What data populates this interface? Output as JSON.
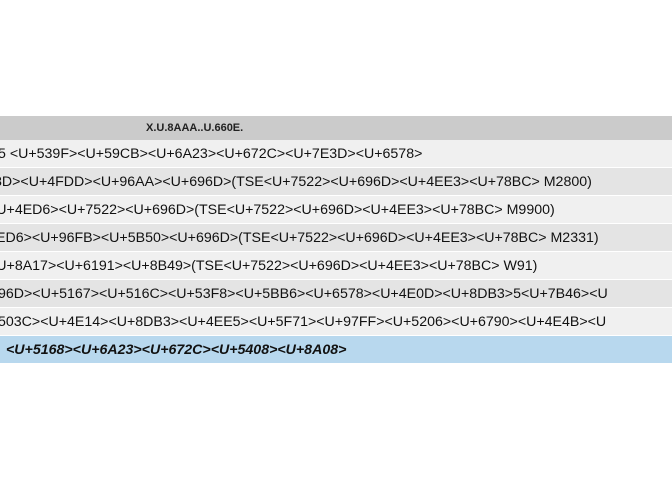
{
  "table": {
    "column_header": "X.U.8AAA..U.660E.",
    "rows": [
      {
        "text": "5 <U+539F><U+59CB><U+6A23><U+672C><U+7E3D><U+6578>",
        "offset": -2
      },
      {
        "text": "8D><U+4FDD><U+96AA><U+696D>(TSE<U+7522><U+696D><U+4EE3><U+78BC> M2800)",
        "offset": -6
      },
      {
        "text": "<U+4ED6><U+7522><U+696D>(TSE<U+7522><U+696D><U+4EE3><U+78BC> M9900)",
        "offset": -12
      },
      {
        "text": "ED6><U+96FB><U+5B50><U+696D>(TSE<U+7522><U+696D><U+4EE3><U+78BC> M2331)",
        "offset": -4
      },
      {
        "text": "<U+8A17><U+6191><U+8B49>(TSE<U+7522><U+696D><U+4EE3><U+78BC> W91)",
        "offset": -12
      },
      {
        "text": "96D><U+5167><U+516C><U+53F8><U+5BB6><U+6578><U+4E0D><U+8DB3>5<U+7B46><U",
        "offset": -2
      },
      {
        "text": "503C><U+4E14><U+8DB3><U+4EE5><U+5F71><U+97FF><U+5206><U+6790><U+4E4B><U",
        "offset": -2
      },
      {
        "text": "<U+5168><U+6A23><U+672C><U+5408><U+8A08>",
        "offset": 6,
        "selected": true
      }
    ]
  }
}
